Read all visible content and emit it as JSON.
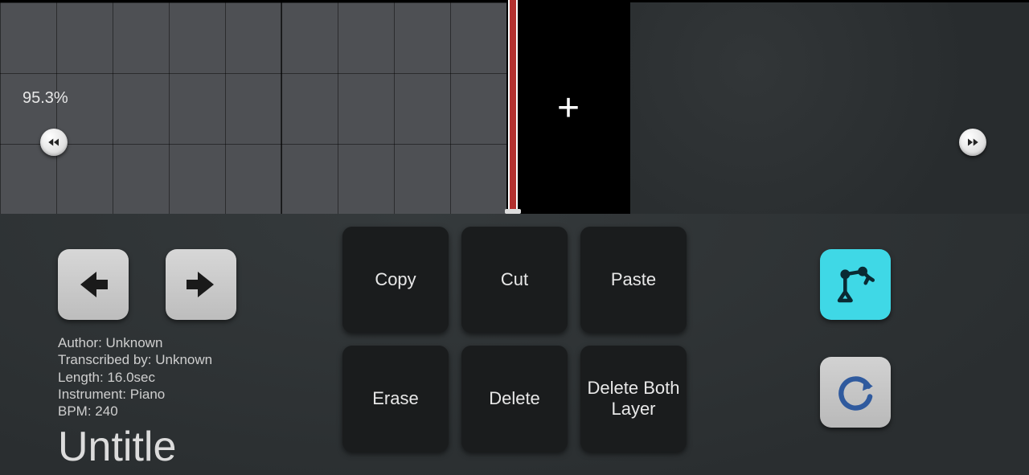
{
  "timeline": {
    "zoom_percent": "95.3%",
    "add_segment_glyph": "+"
  },
  "seek": {
    "back_icon": "rewind-icon",
    "forward_icon": "fast-forward-icon"
  },
  "nav": {
    "prev_icon": "arrow-left-icon",
    "next_icon": "arrow-right-icon"
  },
  "meta": {
    "author_line": "Author: Unknown",
    "transcribed_line": "Transcribed by: Unknown",
    "length_line": "Length: 16.0sec",
    "instrument_line": "Instrument: Piano",
    "bpm_line": "BPM: 240"
  },
  "title": "Untitle",
  "actions": {
    "copy": "Copy",
    "cut": "Cut",
    "paste": "Paste",
    "erase": "Erase",
    "delete": "Delete",
    "delete_both": "Delete Both Layer"
  },
  "tools": {
    "autoplay_icon": "robot-arm-icon",
    "refresh_icon": "refresh-icon"
  },
  "colors": {
    "accent_cyan": "#3fd8e6",
    "playhead_red": "#b3312f"
  }
}
